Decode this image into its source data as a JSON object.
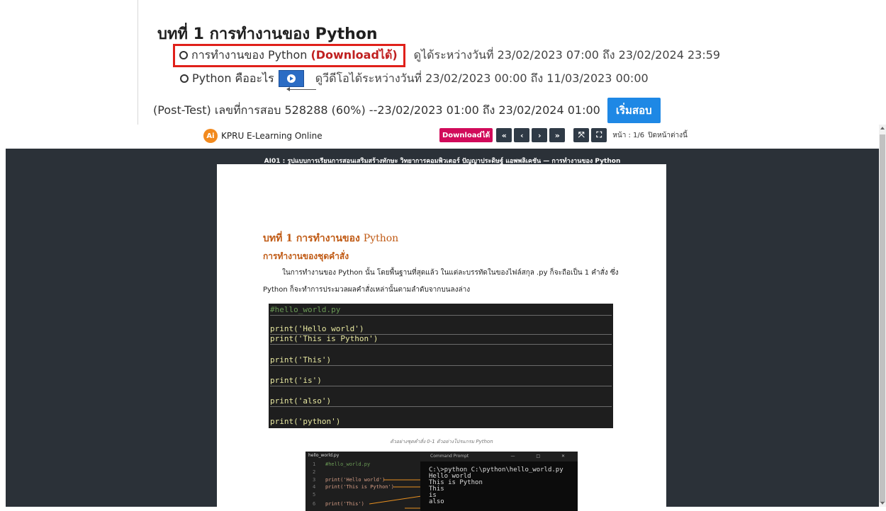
{
  "lesson": {
    "title": "บทที่ 1 การทำงานของ Python",
    "item1": {
      "label": "การทำงานของ Python",
      "download": "(Downloadได้)",
      "availability": "ดูได้ระหว่างวันที่ 23/02/2023 07:00 ถึง 23/02/2024 23:59"
    },
    "item2": {
      "label": "Python คืออะไร",
      "availability": "ดูวีดีโอได้ระหว่างวันที่ 23/02/2023 00:00 ถึง 11/03/2023 00:00"
    },
    "posttest": {
      "text": "(Post-Test) เลขที่การสอบ 528288 (60%) --23/02/2023 01:00 ถึง 23/02/2024 01:00",
      "button": "เริ่มสอบ"
    }
  },
  "viewer": {
    "brand_logo": "Ai",
    "brand": "KPRU E-Learning Online",
    "download_btn": "Downloadได้",
    "nav": {
      "first": "«",
      "prev": "‹",
      "next": "›",
      "last": "»",
      "fit": "⤧",
      "full": "⛶"
    },
    "page_info": "หน้า : 1/6",
    "close_text": "ปิดหน้าต่างนี้",
    "doc_header": "AI01 : รูปแบบการเรียนการสอนเสริมสร้างทักษะ วิทยาการคอมพิวเตอร์ ปัญญาประดิษฐ์ แอพพลิเคชัน — การทำงานของ Python"
  },
  "page": {
    "title_th": "บทที่ 1 การทำงานของ",
    "title_py": "Python",
    "subtitle": "การทำงานของชุดคำสั่ง",
    "para1": "ในการทำงานของ Python นั้น โดยพื้นฐานที่สุดแล้ว ในแต่ละบรรทัดในของไฟล์สกุล .py ก็จะถือเป็น 1 คำสั่ง ซึ่ง",
    "para2": "Python ก็จะทำการประมวลผลคำสั่งเหล่านั้นตามลำดับจากบนลงล่าง",
    "code": [
      "#hello_world.py",
      "print('Hello world')",
      "print('This is Python')",
      "print('This')",
      "print('is')",
      "print('also')",
      "print('python')"
    ],
    "caption": "ตัวอย่างชุดคำสั่ง 0-1 ตัวอย่างโปรแกรม Python",
    "editor_tab": "hello_world.py",
    "editor_lines": [
      "#hello_world.py",
      "",
      "print('Hello world')",
      "print('This is Python')",
      "",
      "print('This')"
    ],
    "cmd_title": "Command Prompt",
    "cmd_controls": "— □ ✕",
    "cmd_output": "C:\\>python C:\\python\\hello_world.py\nHello world\nThis is Python\nThis\nis\nalso"
  }
}
